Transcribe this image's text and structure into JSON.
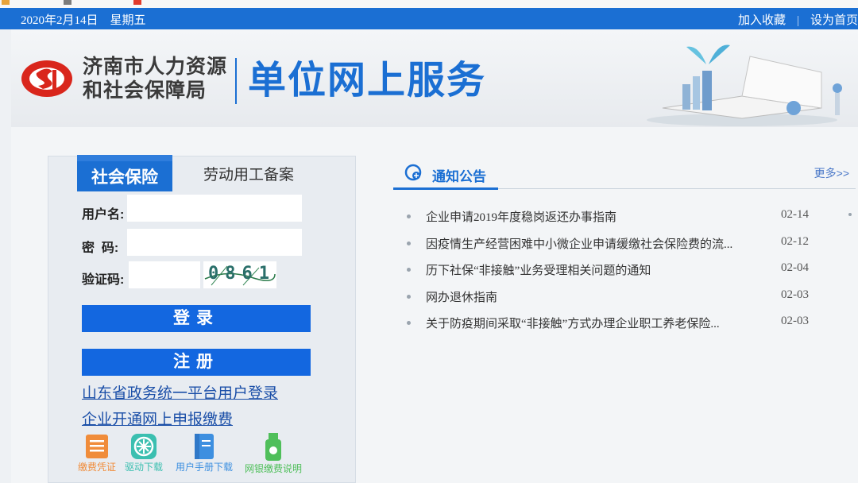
{
  "top_bar": {
    "date": "2020年2月14日    星期五",
    "add_favorite": "加入收藏",
    "set_homepage": "设为首页",
    "separator": "|"
  },
  "header": {
    "org_line1": "济南市人力资源",
    "org_line2": "和社会保障局",
    "service_title": "单位网上服务"
  },
  "login": {
    "tab_social": "社会保险",
    "tab_labor": "劳动用工备案",
    "username_label": "用户名:",
    "password_label": "密  码:",
    "captcha_label": "验证码:",
    "captcha_text": "0861",
    "login_button": "登录",
    "register_button": "注册",
    "link_province": "山东省政务统一平台用户登录",
    "link_enable": "企业开通网上申报缴费"
  },
  "tools": [
    {
      "label": "缴费凭证",
      "icon": "receipt-icon",
      "color": "#f08c3a"
    },
    {
      "label": "驱动下载",
      "icon": "download-driver-icon",
      "color": "#3bbfb0"
    },
    {
      "label": "用户手册下载",
      "icon": "manual-icon",
      "color": "#3d8fe0"
    },
    {
      "label": "网银缴费说明",
      "icon": "usb-key-icon",
      "color": "#4fbf5a"
    }
  ],
  "notices": {
    "title": "通知公告",
    "more": "更多>>",
    "items": [
      {
        "text": "企业申请2019年度稳岗返还办事指南",
        "date": "02-14"
      },
      {
        "text": "因疫情生产经营困难中小微企业申请缓缴社会保险费的流...",
        "date": "02-12"
      },
      {
        "text": "历下社保“非接触”业务受理相关问题的通知",
        "date": "02-04"
      },
      {
        "text": "网办退休指南",
        "date": "02-03"
      },
      {
        "text": "关于防疫期间采取“非接触”方式办理企业职工养老保险...",
        "date": "02-03"
      }
    ]
  },
  "colors": {
    "brand_blue": "#1b6fd3",
    "button_blue": "#1367e0",
    "logo_red": "#d9261c"
  }
}
